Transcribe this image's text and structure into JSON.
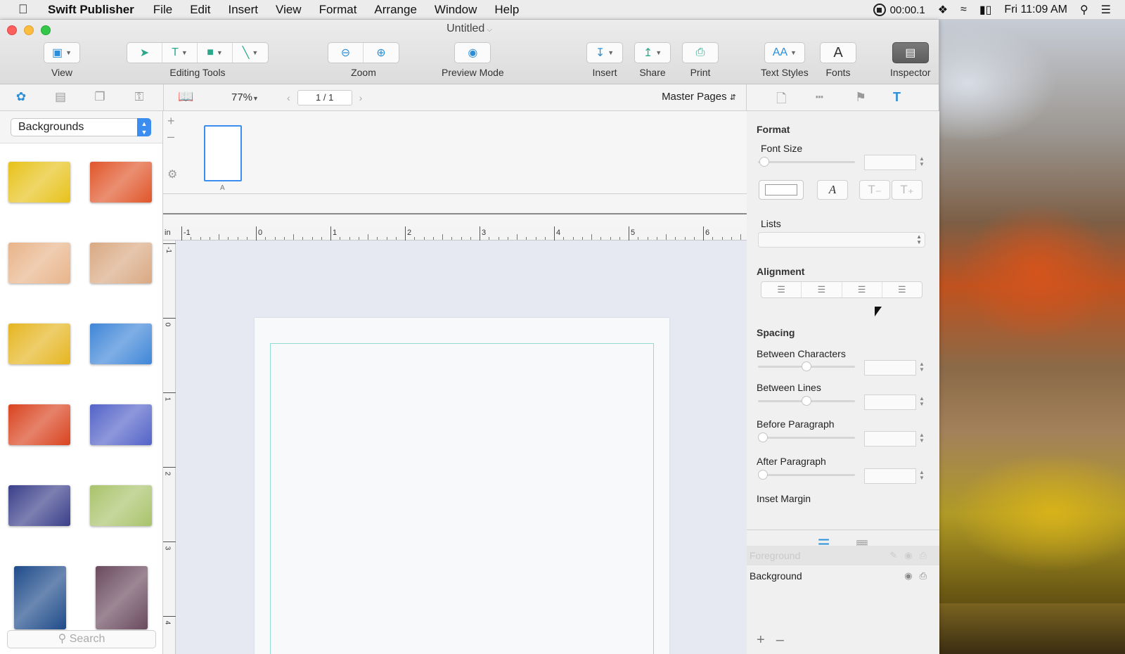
{
  "menubar": {
    "app_name": "Swift Publisher",
    "menus": [
      "File",
      "Edit",
      "Insert",
      "View",
      "Format",
      "Arrange",
      "Window",
      "Help"
    ],
    "recording_time": "00:00.1",
    "clock": "Fri 11:09 AM"
  },
  "window": {
    "title": "Untitled"
  },
  "toolbar": {
    "view_label": "View",
    "editing_tools_label": "Editing Tools",
    "zoom_label": "Zoom",
    "preview_label": "Preview Mode",
    "insert_label": "Insert",
    "share_label": "Share",
    "print_label": "Print",
    "text_styles_label": "Text Styles",
    "fonts_label": "Fonts",
    "inspector_label": "Inspector"
  },
  "canvas_toolbar": {
    "zoom_value": "77%",
    "page_indicator": "1 / 1",
    "master_pages": "Master Pages"
  },
  "left_panel": {
    "category": "Backgrounds",
    "search_placeholder": "Search",
    "thumbnails": [
      {
        "name": "yellow-texture",
        "color": "#e7c21a"
      },
      {
        "name": "orange-red-texture",
        "color": "#e0562a"
      },
      {
        "name": "dots-texture",
        "color": "#e8b48a"
      },
      {
        "name": "wood-texture",
        "color": "#d9a983"
      },
      {
        "name": "yellow-blue-texture",
        "color": "#e5b520"
      },
      {
        "name": "blue-texture",
        "color": "#3f86d8"
      },
      {
        "name": "red-texture",
        "color": "#d9431f"
      },
      {
        "name": "blue-purple-texture",
        "color": "#5363c8"
      },
      {
        "name": "navy-floral-texture",
        "color": "#3a3f8a"
      },
      {
        "name": "green-texture",
        "color": "#a9c36b"
      },
      {
        "name": "dark-blue-texture",
        "color": "#1f4b8a"
      },
      {
        "name": "dark-pink-texture",
        "color": "#6a4a5e"
      }
    ]
  },
  "pages_strip": {
    "page_label": "A"
  },
  "ruler": {
    "unit": "in",
    "h_ticks": [
      "-1",
      "0",
      "1",
      "2",
      "3",
      "4",
      "5",
      "6"
    ],
    "v_ticks": [
      "-1",
      "0",
      "1",
      "2",
      "3",
      "4"
    ]
  },
  "inspector": {
    "format_title": "Format",
    "font_size_label": "Font Size",
    "lists_label": "Lists",
    "alignment_title": "Alignment",
    "spacing_title": "Spacing",
    "between_characters_label": "Between Characters",
    "between_lines_label": "Between Lines",
    "before_paragraph_label": "Before Paragraph",
    "after_paragraph_label": "After Paragraph",
    "inset_margin_label": "Inset Margin",
    "layers": [
      {
        "name": "Foreground",
        "selected": true
      },
      {
        "name": "Background",
        "selected": false
      }
    ]
  }
}
